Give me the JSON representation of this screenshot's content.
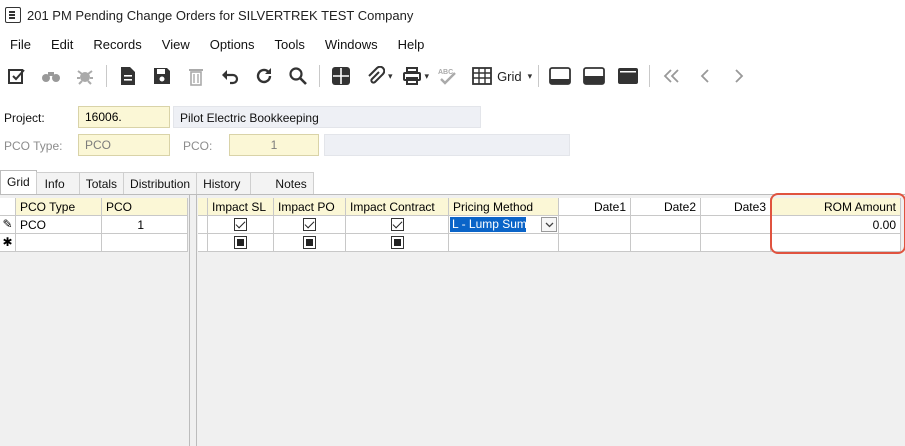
{
  "window": {
    "title": "201 PM Pending Change Orders for SILVERTREK TEST Company",
    "icon": "document-list-icon"
  },
  "menu": [
    "File",
    "Edit",
    "Records",
    "View",
    "Options",
    "Tools",
    "Windows",
    "Help"
  ],
  "toolbar": {
    "grid_label": "Grid"
  },
  "form": {
    "project_label": "Project:",
    "project_value": "16006.",
    "project_name": "Pilot Electric Bookkeeping",
    "pco_type_label": "PCO Type:",
    "pco_type_value": "PCO",
    "pco_label": "PCO:",
    "pco_value": "1",
    "pco_desc": ""
  },
  "tabs": [
    "Grid",
    "Info",
    "Totals",
    "Distribution",
    "History",
    "Notes"
  ],
  "active_tab": "Grid",
  "grid": {
    "left_headers": [
      "PCO Type",
      "PCO"
    ],
    "right_headers": [
      "Impact SL",
      "Impact PO",
      "Impact Contract",
      "Pricing Method",
      "Date1",
      "Date2",
      "Date3",
      "ROM Amount"
    ],
    "rows": [
      {
        "indicator": "✎",
        "pco_type": "PCO",
        "pco": "1",
        "impact_sl": "checked",
        "impact_po": "checked",
        "impact_contract": "checked",
        "pricing_method": "L - Lump Sum",
        "date1": "",
        "date2": "",
        "date3": "",
        "rom_amount": "0.00"
      },
      {
        "indicator": "✱",
        "pco_type": "",
        "pco": "",
        "impact_sl": "indeterminate",
        "impact_po": "indeterminate",
        "impact_contract": "indeterminate",
        "pricing_method": "",
        "date1": "",
        "date2": "",
        "date3": "",
        "rom_amount": ""
      }
    ]
  },
  "colors": {
    "field_bg": "#fbf7d6",
    "selection": "#0a64c8",
    "highlight": "#e0533f"
  }
}
